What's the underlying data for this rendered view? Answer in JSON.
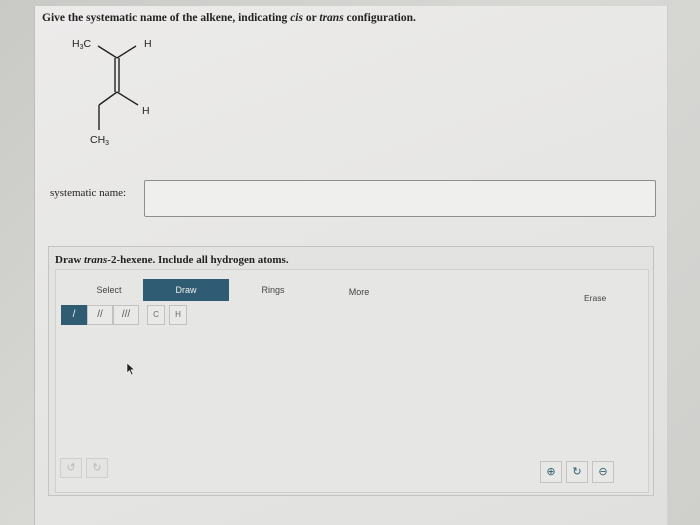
{
  "question": {
    "prefix": "Give the systematic name of the alkene, indicating ",
    "cis": "cis",
    "or": " or ",
    "trans": "trans",
    "suffix": " configuration."
  },
  "molecule": {
    "label_h3c": "H",
    "label_h3c_sub": "3",
    "label_h3c_tail": "C",
    "label_h_top": "H",
    "label_h_right": "H",
    "label_ch3": "CH",
    "label_ch3_sub": "3"
  },
  "answer": {
    "label": "systematic name:",
    "value": ""
  },
  "draw": {
    "prompt_prefix": "Draw ",
    "prompt_italic": "trans",
    "prompt_suffix": "-2-hexene. Include all hydrogen atoms.",
    "tabs": [
      "Select",
      "Draw",
      "Rings",
      "More"
    ],
    "active_tab": "Draw",
    "erase": "Erase",
    "bond_tools": [
      "/",
      "//",
      "///"
    ],
    "atom_tools": [
      "C",
      "H"
    ]
  },
  "colors": {
    "accent": "#2f5c73"
  }
}
